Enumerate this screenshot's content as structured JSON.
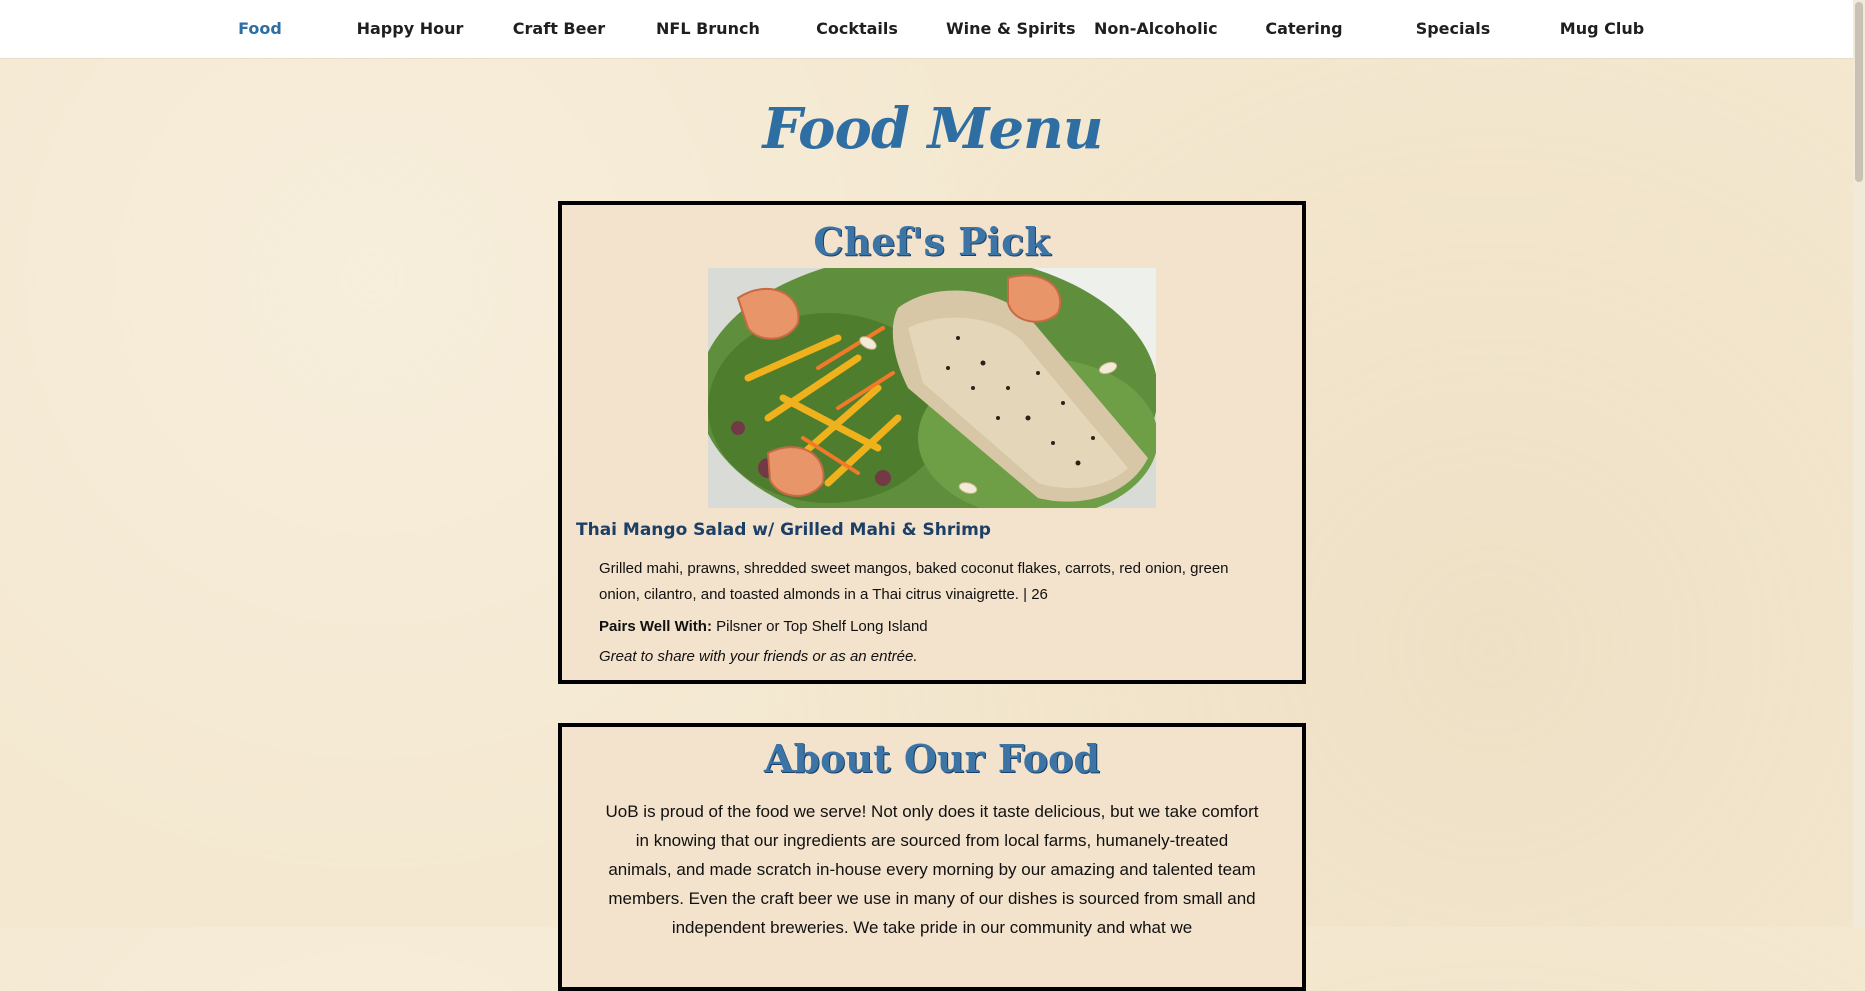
{
  "nav": {
    "items": [
      {
        "label": "Food",
        "active": true
      },
      {
        "label": "Happy Hour"
      },
      {
        "label": "Craft Beer"
      },
      {
        "label": "NFL Brunch"
      },
      {
        "label": "Cocktails"
      },
      {
        "label": "Wine & Spirits"
      },
      {
        "label": "Non-Alcoholic"
      },
      {
        "label": "Catering"
      },
      {
        "label": "Specials"
      },
      {
        "label": "Mug Club"
      }
    ]
  },
  "page": {
    "title": "Food Menu"
  },
  "chefs_pick": {
    "heading": "Chef's Pick",
    "item_name": "Thai Mango Salad w/ Grilled Mahi & Shrimp",
    "description": "Grilled mahi, prawns, shredded sweet mangos, baked coconut flakes, carrots, red onion, green onion, cilantro, and toasted almonds in a Thai citrus vinaigrette. | 26",
    "pairs_label": "Pairs Well With:",
    "pairs_value": " Pilsner or Top Shelf Long Island",
    "note": "Great to share with your friends or as an entrée."
  },
  "about": {
    "heading": "About Our Food",
    "text": "UoB is proud of the food we serve! Not only does it taste delicious, but we take comfort in knowing that our ingredients are sourced from local farms, humanely-treated animals, and made scratch in-house every morning by our amazing and talented team members. Even the craft beer we use in many of our dishes is sourced from small and independent breweries. We take pride in our community and what we"
  },
  "colors": {
    "accent": "#2e6ea3",
    "heading_blue": "#3d74a6",
    "item_name_blue": "#1b3f66",
    "background": "#f4e8d0",
    "box_background": "#f3e2cc",
    "border": "#000000"
  }
}
